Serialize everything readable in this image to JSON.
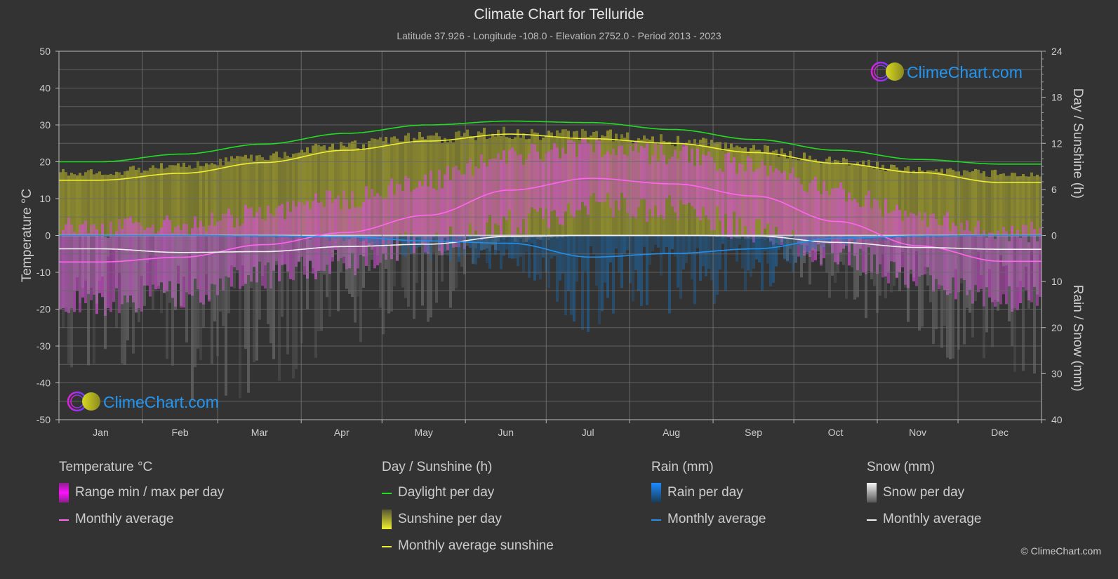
{
  "header": {
    "title": "Climate Chart for Telluride",
    "subtitle": "Latitude 37.926 - Longitude -108.0 - Elevation 2752.0 - Period 2013 - 2023"
  },
  "watermark": {
    "text": "ClimeChart.com"
  },
  "copyright": "© ClimeChart.com",
  "colors": {
    "background": "#333333",
    "grid": "#5a5a5a",
    "temp_range": "#e030e0",
    "temp_avg": "#ff66ee",
    "daylight": "#22dd22",
    "sunshine_fill": "#9c9a30",
    "sunshine_avg": "#eeee33",
    "rain": "#1a8cff",
    "rain_avg": "#2090ee",
    "snow": "#aaaaaa",
    "snow_avg": "#f0f0f0",
    "brand": "#2196f3"
  },
  "legend": {
    "temperature": {
      "heading": "Temperature °C",
      "items": [
        "Range min / max per day",
        "Monthly average"
      ]
    },
    "sunshine": {
      "heading": "Day / Sunshine (h)",
      "items": [
        "Daylight per day",
        "Sunshine per day",
        "Monthly average sunshine"
      ]
    },
    "rain": {
      "heading": "Rain (mm)",
      "items": [
        "Rain per day",
        "Monthly average"
      ]
    },
    "snow": {
      "heading": "Snow (mm)",
      "items": [
        "Snow per day",
        "Monthly average"
      ]
    }
  },
  "chart_data": {
    "type": "line",
    "title": "Climate Chart for Telluride",
    "categories": [
      "Jan",
      "Feb",
      "Mar",
      "Apr",
      "May",
      "Jun",
      "Jul",
      "Aug",
      "Sep",
      "Oct",
      "Nov",
      "Dec"
    ],
    "axes": {
      "left": {
        "label": "Temperature °C",
        "range": [
          -50,
          50
        ],
        "ticks": [
          50,
          40,
          30,
          20,
          10,
          0,
          -10,
          -20,
          -30,
          -40,
          -50
        ]
      },
      "right_top": {
        "label": "Day / Sunshine (h)",
        "range": [
          0,
          24
        ],
        "ticks": [
          24,
          18,
          12,
          6,
          0
        ]
      },
      "right_bottom": {
        "label": "Rain / Snow (mm)",
        "range": [
          0,
          40
        ],
        "ticks": [
          10,
          20,
          30,
          40
        ],
        "inverted": true
      }
    },
    "grid": true,
    "series": [
      {
        "name": "Daylight per day",
        "unit": "h",
        "axis": "right_top",
        "values": [
          9.6,
          10.6,
          11.9,
          13.3,
          14.4,
          14.9,
          14.7,
          13.8,
          12.5,
          11.1,
          9.9,
          9.3
        ]
      },
      {
        "name": "Sunshine per day (upper envelope)",
        "unit": "h",
        "axis": "right_top",
        "values": [
          8.6,
          9.5,
          10.8,
          12.2,
          13.3,
          13.9,
          13.7,
          12.9,
          11.6,
          10.1,
          8.9,
          8.4
        ]
      },
      {
        "name": "Monthly average sunshine",
        "unit": "h",
        "axis": "right_top",
        "values": [
          7.2,
          8.1,
          9.5,
          11.1,
          12.3,
          13.2,
          12.6,
          12.0,
          10.8,
          9.4,
          8.2,
          6.9
        ]
      },
      {
        "name": "Temperature monthly average",
        "unit": "°C",
        "axis": "left",
        "values": [
          -7.2,
          -5.9,
          -2.5,
          0.8,
          5.5,
          12.3,
          15.5,
          14.0,
          10.7,
          3.8,
          -2.8,
          -7.0
        ]
      },
      {
        "name": "Temperature daily max (approx)",
        "unit": "°C",
        "axis": "left",
        "values": [
          2,
          3,
          6,
          10,
          15,
          22,
          24,
          22,
          19,
          12,
          5,
          1
        ]
      },
      {
        "name": "Temperature daily min (approx)",
        "unit": "°C",
        "axis": "left",
        "values": [
          -18,
          -16,
          -11,
          -7,
          -2,
          3,
          8,
          7,
          2,
          -5,
          -11,
          -17
        ]
      },
      {
        "name": "Rain monthly average",
        "unit": "mm",
        "axis": "right_bottom",
        "values": [
          0.0,
          0.0,
          0.1,
          0.3,
          1.2,
          1.7,
          4.7,
          3.9,
          2.9,
          0.6,
          0.1,
          0.0
        ]
      },
      {
        "name": "Snow monthly average",
        "unit": "mm",
        "axis": "right_bottom",
        "values": [
          2.9,
          3.7,
          3.5,
          2.4,
          1.9,
          0.2,
          0.0,
          0.0,
          0.1,
          1.5,
          2.6,
          3.0
        ]
      }
    ]
  }
}
